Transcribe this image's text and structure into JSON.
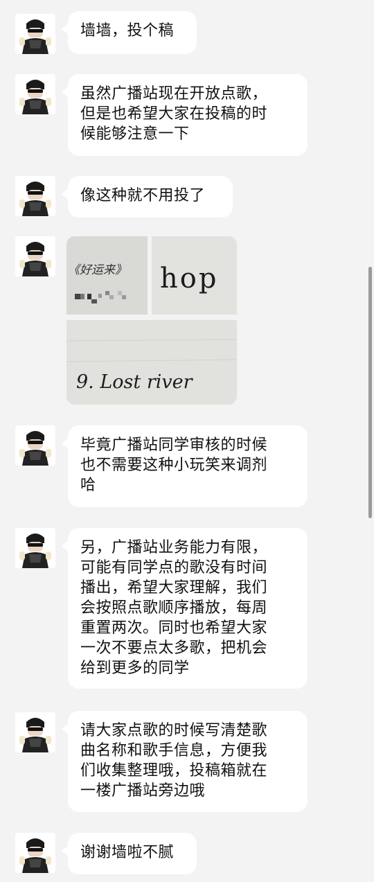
{
  "chat": {
    "messages": [
      {
        "text": "墙墙，投个稿"
      },
      {
        "text": "虽然广播站现在开放点歌，\n但是也希望大家在投稿的时\n候能够注意一下"
      },
      {
        "text": "像这种就不用投了"
      },
      {
        "image": {
          "photos": [
            {
              "text": "《好运来》",
              "tag": "kids-grid-photo"
            },
            {
              "text": "hop"
            },
            {
              "text": "9. Lost river"
            }
          ]
        }
      },
      {
        "text": "毕竟广播站同学审核的时候\n也不需要这种小玩笑来调剂\n哈"
      },
      {
        "text": "另，广播站业务能力有限，\n可能有同学点的歌没有时间\n播出，希望大家理解，我们\n会按照点歌顺序播放，每周\n重置两次。同时也希望大家\n一次不要点太多歌，把机会\n给到更多的同学"
      },
      {
        "text": "请大家点歌的时候写清楚歌\n曲名称和歌手信息，方便我\n们收集整理哦，投稿箱就在\n一楼广播站旁边哦"
      },
      {
        "text": "谢谢墙啦不腻"
      }
    ]
  },
  "colors": {
    "background": "#f3f3f3",
    "bubble": "#ffffff",
    "text": "#111111"
  }
}
